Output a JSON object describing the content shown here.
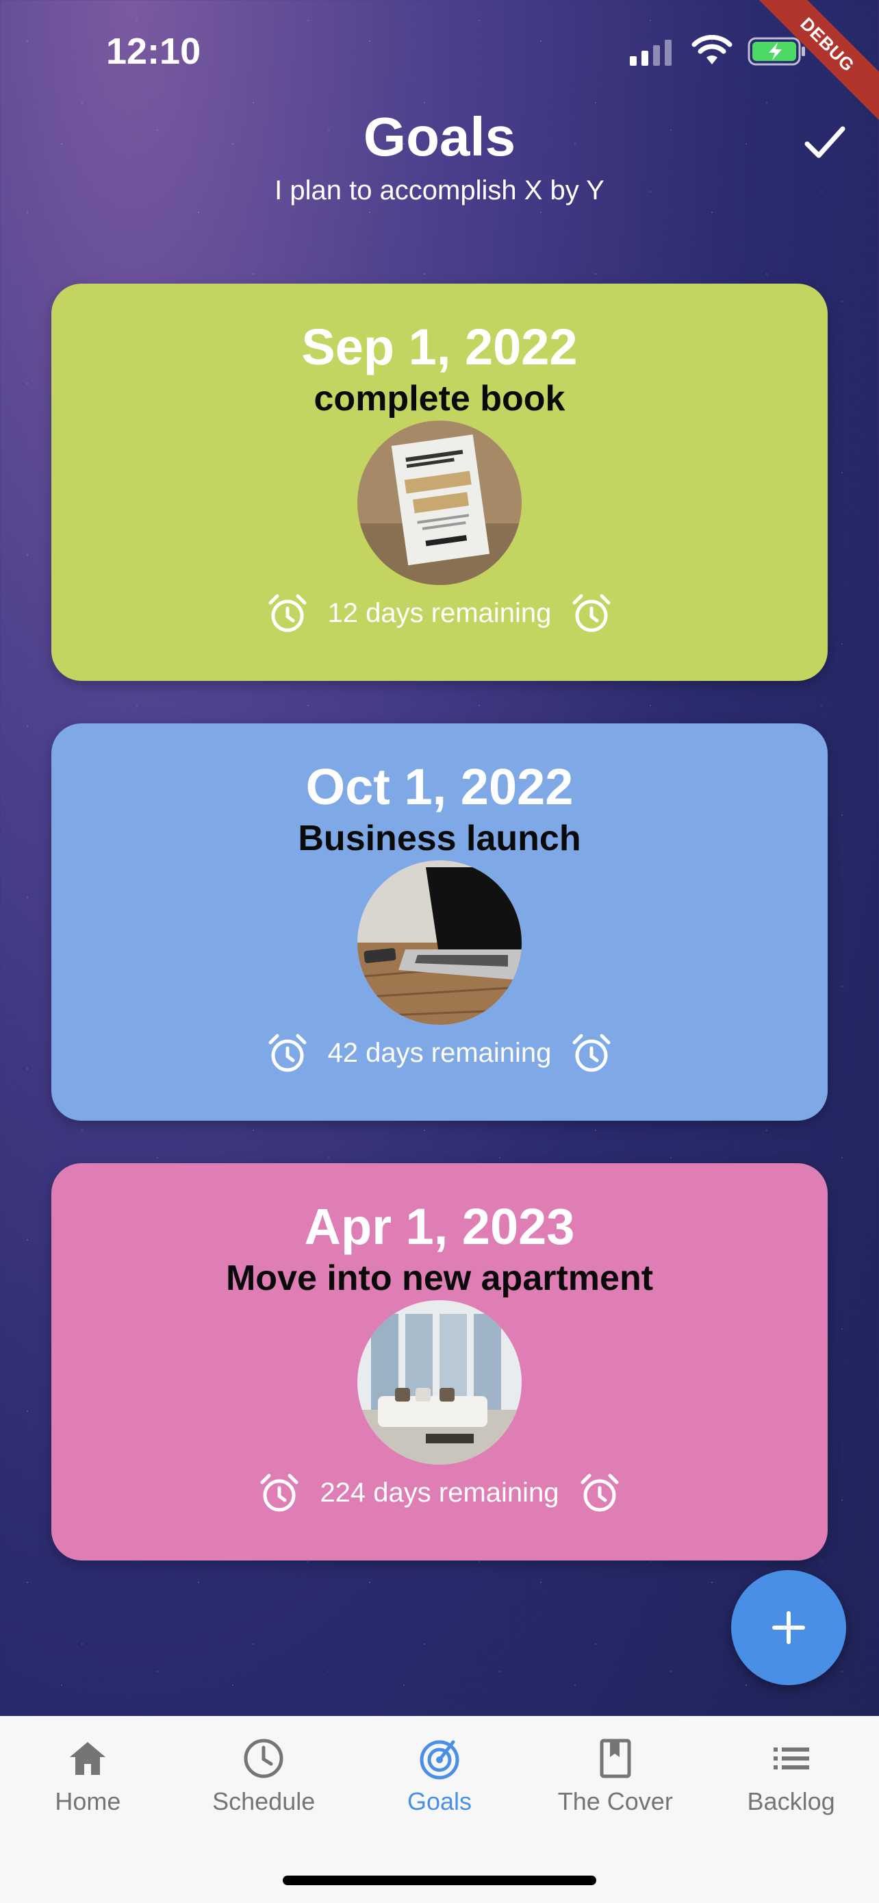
{
  "status_bar": {
    "time": "12:10",
    "debug_banner": "DEBUG"
  },
  "header": {
    "title": "Goals",
    "subtitle": "I plan to accomplish X by Y"
  },
  "goals": [
    {
      "date": "Sep 1, 2022",
      "title": "complete book",
      "remaining": "12 days remaining",
      "color": "#c3d560",
      "image": "book-cover-photo"
    },
    {
      "date": "Oct 1, 2022",
      "title": "Business launch",
      "remaining": "42 days remaining",
      "color": "#7ea9e6",
      "image": "laptop-photo"
    },
    {
      "date": "Apr 1, 2023",
      "title": "Move into new apartment",
      "remaining": "224 days remaining",
      "color": "#df7db5",
      "image": "apartment-photo"
    }
  ],
  "fab": {
    "icon": "plus-icon",
    "color": "#4a8fe6"
  },
  "tabs": [
    {
      "label": "Home",
      "icon": "home-icon"
    },
    {
      "label": "Schedule",
      "icon": "clock-icon"
    },
    {
      "label": "Goals",
      "icon": "target-icon",
      "active": true
    },
    {
      "label": "The Cover",
      "icon": "bookmark-icon"
    },
    {
      "label": "Backlog",
      "icon": "list-icon"
    }
  ],
  "colors": {
    "accent": "#4a8fe6",
    "tab_inactive": "#757575"
  }
}
